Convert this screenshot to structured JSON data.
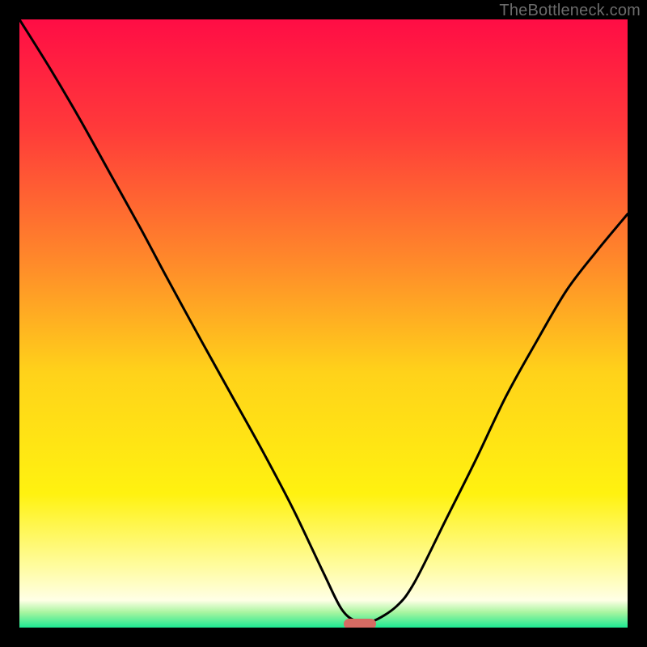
{
  "attribution": "TheBottleneck.com",
  "palette": {
    "frame": "#000000",
    "curve": "#000000",
    "marker": "#d66b63",
    "gradient_stops": [
      {
        "offset": 0.0,
        "color": "#ff0d45"
      },
      {
        "offset": 0.18,
        "color": "#ff3a3a"
      },
      {
        "offset": 0.4,
        "color": "#ff8a2a"
      },
      {
        "offset": 0.58,
        "color": "#ffd21a"
      },
      {
        "offset": 0.78,
        "color": "#fff210"
      },
      {
        "offset": 0.9,
        "color": "#fffca0"
      },
      {
        "offset": 0.955,
        "color": "#ffffe6"
      },
      {
        "offset": 0.975,
        "color": "#a8f5a0"
      },
      {
        "offset": 1.0,
        "color": "#1ce892"
      }
    ]
  },
  "chart_data": {
    "type": "line",
    "title": "",
    "xlabel": "",
    "ylabel": "",
    "xlim": [
      0,
      1
    ],
    "ylim": [
      0,
      1
    ],
    "grid": false,
    "legend": false,
    "series": [
      {
        "name": "bottleneck-curve",
        "x": [
          0.0,
          0.05,
          0.1,
          0.15,
          0.2,
          0.24,
          0.3,
          0.35,
          0.4,
          0.45,
          0.5,
          0.53,
          0.555,
          0.58,
          0.62,
          0.65,
          0.7,
          0.75,
          0.8,
          0.85,
          0.9,
          0.95,
          1.0
        ],
        "y": [
          1.0,
          0.92,
          0.835,
          0.745,
          0.655,
          0.58,
          0.47,
          0.38,
          0.29,
          0.195,
          0.09,
          0.03,
          0.01,
          0.01,
          0.035,
          0.075,
          0.175,
          0.275,
          0.38,
          0.47,
          0.555,
          0.62,
          0.68
        ]
      }
    ],
    "marker": {
      "x_center": 0.56,
      "y": 0.006,
      "width": 0.053,
      "height": 0.018
    },
    "annotations": []
  }
}
